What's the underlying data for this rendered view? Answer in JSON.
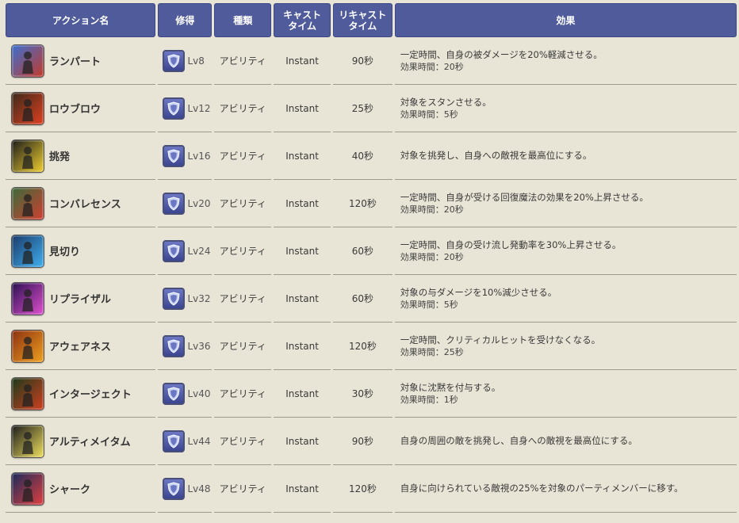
{
  "headers": {
    "name": "アクション名",
    "learn": "修得",
    "type": "種類",
    "cast": "キャスト\nタイム",
    "recast": "リキャスト\nタイム",
    "effect": "効果"
  },
  "rows": [
    {
      "name": "ランパート",
      "lv": "Lv8",
      "type": "アビリティ",
      "cast": "Instant",
      "recast": "90秒",
      "effect1": "一定時間、自身の被ダメージを20%軽減させる。",
      "effect2": "効果時間：20秒",
      "icon": "rampart-icon",
      "colors": [
        "#3b6fd0",
        "#c43a2a"
      ]
    },
    {
      "name": "ロウブロウ",
      "lv": "Lv12",
      "type": "アビリティ",
      "cast": "Instant",
      "recast": "25秒",
      "effect1": "対象をスタンさせる。",
      "effect2": "効果時間：5秒",
      "icon": "low-blow-icon",
      "colors": [
        "#3a2a1a",
        "#e04020"
      ]
    },
    {
      "name": "挑発",
      "lv": "Lv16",
      "type": "アビリティ",
      "cast": "Instant",
      "recast": "40秒",
      "effect1": "対象を挑発し、自身への敵視を最高位にする。",
      "effect2": "",
      "icon": "provoke-icon",
      "colors": [
        "#1a1a1a",
        "#f0d030"
      ]
    },
    {
      "name": "コンバレセンス",
      "lv": "Lv20",
      "type": "アビリティ",
      "cast": "Instant",
      "recast": "120秒",
      "effect1": "一定時間、自身が受ける回復魔法の効果を20%上昇させる。",
      "effect2": "効果時間：20秒",
      "icon": "convalescence-icon",
      "colors": [
        "#3a6a3a",
        "#d04030"
      ]
    },
    {
      "name": "見切り",
      "lv": "Lv24",
      "type": "アビリティ",
      "cast": "Instant",
      "recast": "60秒",
      "effect1": "一定時間、自身の受け流し発動率を30%上昇させる。",
      "effect2": "効果時間：20秒",
      "icon": "anticipation-icon",
      "colors": [
        "#1a3a6a",
        "#40b0f0"
      ]
    },
    {
      "name": "リプライザル",
      "lv": "Lv32",
      "type": "アビリティ",
      "cast": "Instant",
      "recast": "60秒",
      "effect1": "対象の与ダメージを10%減少させる。",
      "effect2": "効果時間：5秒",
      "icon": "reprisal-icon",
      "colors": [
        "#2a1050",
        "#e050d0"
      ]
    },
    {
      "name": "アウェアネス",
      "lv": "Lv36",
      "type": "アビリティ",
      "cast": "Instant",
      "recast": "120秒",
      "effect1": "一定時間、クリティカルヒットを受けなくなる。",
      "effect2": "効果時間：25秒",
      "icon": "awareness-icon",
      "colors": [
        "#8a3010",
        "#f0a020"
      ]
    },
    {
      "name": "インタージェクト",
      "lv": "Lv40",
      "type": "アビリティ",
      "cast": "Instant",
      "recast": "30秒",
      "effect1": "対象に沈黙を付与する。",
      "effect2": "効果時間：1秒",
      "icon": "interject-icon",
      "colors": [
        "#1a3a1a",
        "#d04020"
      ]
    },
    {
      "name": "アルティメイタム",
      "lv": "Lv44",
      "type": "アビリティ",
      "cast": "Instant",
      "recast": "90秒",
      "effect1": "自身の周囲の敵を挑発し、自身への敵視を最高位にする。",
      "effect2": "",
      "icon": "ultimatum-icon",
      "colors": [
        "#1a1a1a",
        "#f0e060"
      ]
    },
    {
      "name": "シャーク",
      "lv": "Lv48",
      "type": "アビリティ",
      "cast": "Instant",
      "recast": "120秒",
      "effect1": "自身に向けられている敵視の25%を対象のパーティメンバーに移す。",
      "effect2": "",
      "icon": "shirk-icon",
      "colors": [
        "#1a2a5a",
        "#e04040"
      ]
    }
  ]
}
